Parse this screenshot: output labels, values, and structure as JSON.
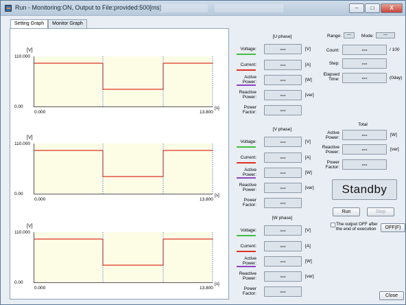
{
  "window": {
    "title": "Run - Monitoring:ON, Output to File:provided:500[ms]",
    "min": "–",
    "max": "□",
    "close": "X"
  },
  "tabs": [
    {
      "label": "Setting Graph"
    },
    {
      "label": "Monitor Graph"
    }
  ],
  "graphs": [
    {
      "unit": "[V]",
      "ymax": "110.000",
      "yzero": "0.00",
      "tstart": "0.000",
      "tend": "13.800",
      "tunit": "[s]"
    },
    {
      "unit": "[V]",
      "ymax": "110.000",
      "yzero": "0.00",
      "tstart": "0.000",
      "tend": "13.800",
      "tunit": "[s]"
    },
    {
      "unit": "[V]",
      "ymax": "110.000",
      "yzero": "0.00",
      "tstart": "0.000",
      "tend": "13.800",
      "tunit": "[s]"
    }
  ],
  "colors": {
    "line": "#e03020",
    "marker": "#4060d0",
    "voltage_ul": "#40c040",
    "current_ul": "#e03020",
    "power_ul": "#9040c0"
  },
  "phases": [
    {
      "title": "[U phase]",
      "rows": [
        {
          "label": "Voltage:",
          "value": "---",
          "unit": "[V]"
        },
        {
          "label": "Current:",
          "value": "---",
          "unit": "[A]"
        },
        {
          "label": "Active Power:",
          "value": "---",
          "unit": "[W]"
        },
        {
          "label": "Reactive Power:",
          "value": "---",
          "unit": "[var]"
        },
        {
          "label": "Power Factor:",
          "value": "---",
          "unit": ""
        }
      ]
    },
    {
      "title": "[V phase]",
      "rows": [
        {
          "label": "Voltage:",
          "value": "---",
          "unit": "[V]"
        },
        {
          "label": "Current:",
          "value": "---",
          "unit": "[A]"
        },
        {
          "label": "Active Power:",
          "value": "---",
          "unit": "[W]"
        },
        {
          "label": "Reactive Power:",
          "value": "---",
          "unit": "[var]"
        },
        {
          "label": "Power Factor:",
          "value": "---",
          "unit": ""
        }
      ]
    },
    {
      "title": "[W phase]",
      "rows": [
        {
          "label": "Voltage:",
          "value": "---",
          "unit": "[V]"
        },
        {
          "label": "Current:",
          "value": "---",
          "unit": "[A]"
        },
        {
          "label": "Active Power:",
          "value": "---",
          "unit": "[W]"
        },
        {
          "label": "Reactive Power:",
          "value": "---",
          "unit": "[var]"
        },
        {
          "label": "Power Factor:",
          "value": "---",
          "unit": ""
        }
      ]
    }
  ],
  "status": {
    "range_label": "Range:",
    "range_value": "---",
    "mode_label": "Mode:",
    "mode_value": "---",
    "count_label": "Count:",
    "count_value": "---",
    "count_total": "/ 100",
    "step_label": "Step:",
    "step_value": "---",
    "elapsed_label": "Elapsed Time:",
    "elapsed_value": "---",
    "elapsed_unit": "(0day)"
  },
  "total": {
    "title": "Total",
    "rows": [
      {
        "label": "Active Power:",
        "value": "---",
        "unit": "[W]"
      },
      {
        "label": "Reactive Power:",
        "value": "---",
        "unit": "[var]"
      },
      {
        "label": "Power Factor:",
        "value": "---",
        "unit": ""
      }
    ]
  },
  "state": "Standby",
  "buttons": {
    "run": "Run",
    "stop": "Stop",
    "off": "OFF(F)",
    "close": "Close"
  },
  "output_off_text": "The output OFF after the end of execution"
}
